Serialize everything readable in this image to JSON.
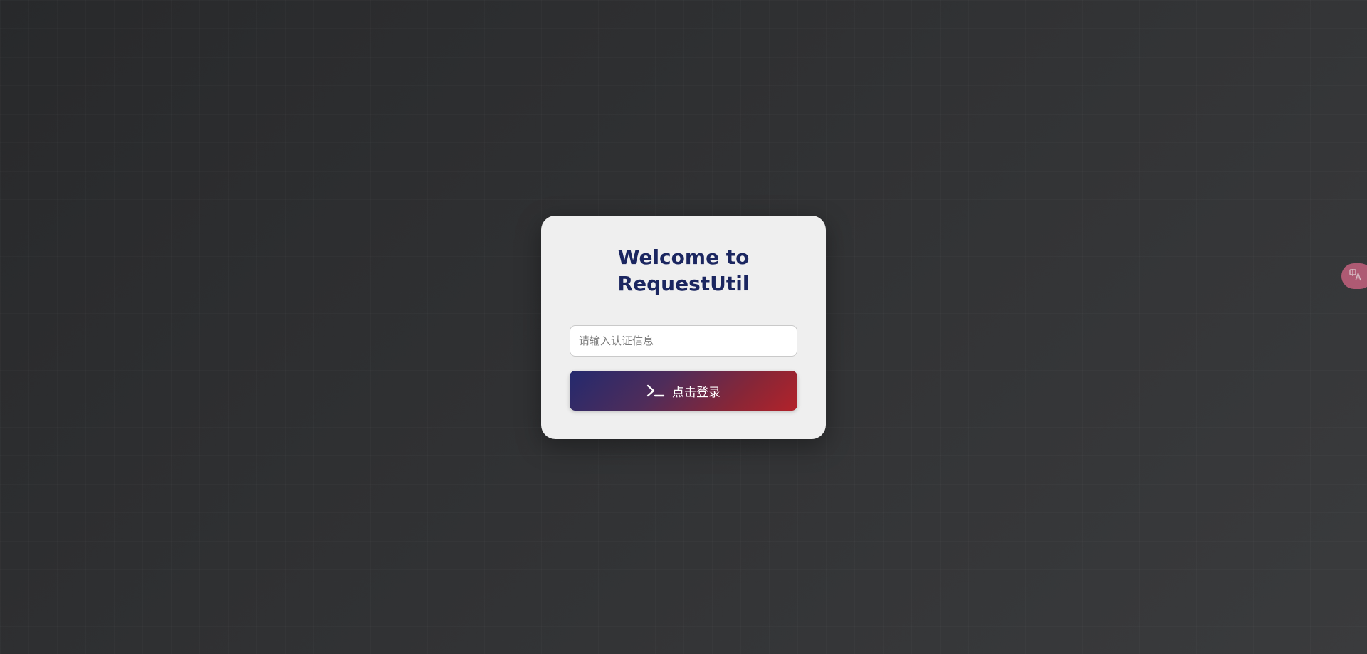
{
  "login": {
    "title": "Welcome to\nRequestUtil",
    "input": {
      "placeholder": "请输入认证信息",
      "value": ""
    },
    "button": {
      "label": "点击登录",
      "icon": "terminal-icon"
    }
  },
  "translate_widget": {
    "icon": "translate-icon"
  },
  "colors": {
    "title": "#1b2660",
    "button_gradient_start": "#242a6e",
    "button_gradient_end": "#b3222a",
    "card_background": "#efefef",
    "page_background": "#2a2b2d",
    "translate_widget": "#c4617e"
  }
}
